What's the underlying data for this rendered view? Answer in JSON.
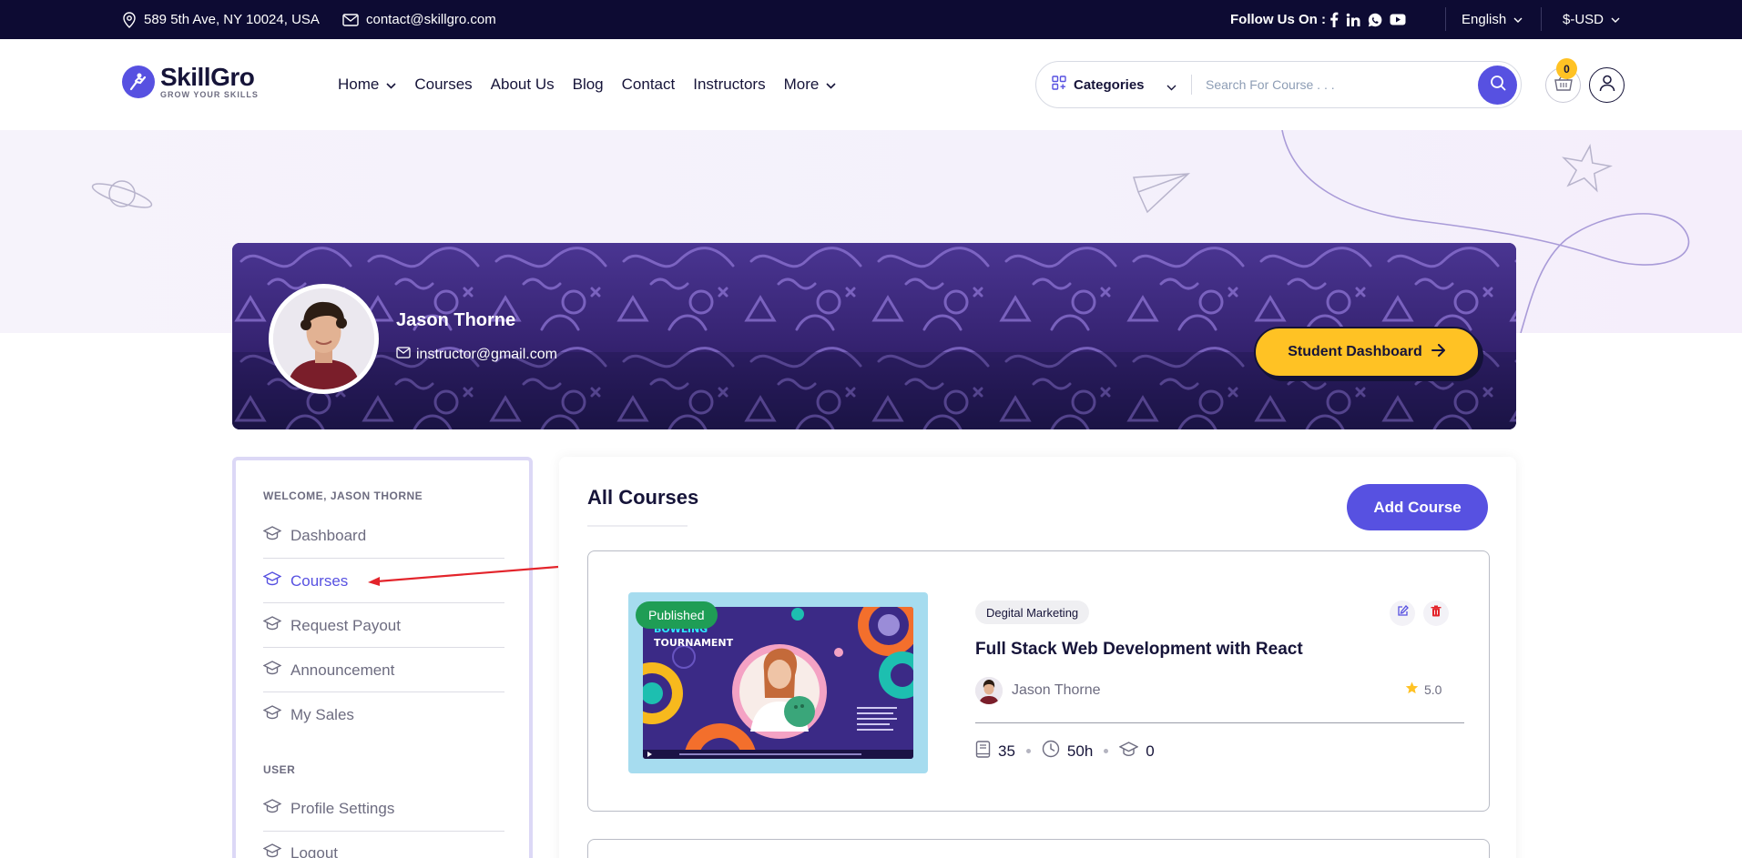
{
  "topbar": {
    "address": "589 5th Ave, NY 10024, USA",
    "email": "contact@skillgro.com",
    "follow_label": "Follow Us On :",
    "social_icons": [
      "facebook-icon",
      "linkedin-icon",
      "whatsapp-icon",
      "youtube-icon"
    ],
    "language": "English",
    "currency": "$-USD"
  },
  "header": {
    "logo_name": "SkillGro",
    "logo_tagline": "GROW YOUR SKILLS",
    "nav": {
      "home": "Home",
      "courses": "Courses",
      "about": "About Us",
      "blog": "Blog",
      "contact": "Contact",
      "instructors": "Instructors",
      "more": "More"
    },
    "categories_label": "Categories",
    "search_placeholder": "Search For Course . . .",
    "cart_count": "0"
  },
  "profile": {
    "name": "Jason Thorne",
    "email": "instructor@gmail.com",
    "dashboard_button": "Student Dashboard"
  },
  "sidebar": {
    "welcome_heading": "WELCOME, JASON THORNE",
    "items": [
      "Dashboard",
      "Courses",
      "Request Payout",
      "Announcement",
      "My Sales"
    ],
    "active_item": "Courses",
    "user_heading": "USER",
    "user_items": [
      "Profile Settings",
      "Logout"
    ]
  },
  "main": {
    "title": "All Courses",
    "add_button": "Add Course",
    "course": {
      "status": "Published",
      "category": "Degital Marketing",
      "title": "Full Stack Web Development with React",
      "instructor": "Jason Thorne",
      "rating": "5.0",
      "lessons": "35",
      "duration": "50h",
      "students": "0",
      "thumb_text_1": "BOWLING",
      "thumb_text_2": "TOURNAMENT"
    }
  },
  "colors": {
    "topbar_bg": "#0d0b33",
    "primary": "#5751e1",
    "accent_yellow": "#ffc224",
    "published_green": "#1f9d55",
    "delete_red": "#e3242b",
    "banner_purple": "#3a2778"
  }
}
